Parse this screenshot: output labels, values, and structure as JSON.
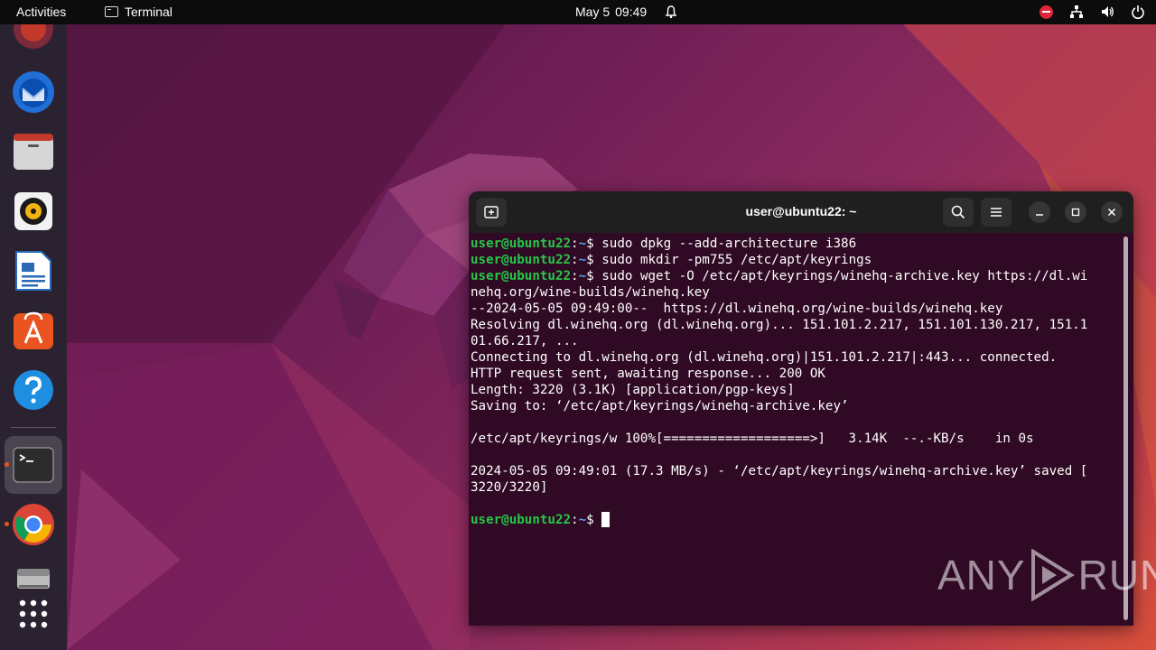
{
  "topbar": {
    "activities": "Activities",
    "app_name": "Terminal",
    "date": "May 5",
    "time": "09:49"
  },
  "dock": {
    "items": [
      "firefox-icon",
      "thunderbird-icon",
      "files-icon",
      "rhythmbox-icon",
      "libreoffice-writer-icon",
      "ubuntu-software-icon",
      "help-icon",
      "terminal-icon",
      "chrome-icon",
      "disk-icon",
      "show-apps-icon"
    ],
    "accent": "#e95420"
  },
  "terminal": {
    "title": "user@ubuntu22: ~",
    "prompt_user": "user@ubuntu22",
    "prompt_sep": ":",
    "prompt_path": "~",
    "prompt_dollar": "$ ",
    "lines": [
      {
        "type": "cmd",
        "text": "sudo dpkg --add-architecture i386"
      },
      {
        "type": "cmd",
        "text": "sudo mkdir -pm755 /etc/apt/keyrings"
      },
      {
        "type": "cmd",
        "text": "sudo wget -O /etc/apt/keyrings/winehq-archive.key https://dl.wi"
      },
      {
        "type": "out",
        "text": "nehq.org/wine-builds/winehq.key"
      },
      {
        "type": "out",
        "text": "--2024-05-05 09:49:00--  https://dl.winehq.org/wine-builds/winehq.key"
      },
      {
        "type": "out",
        "text": "Resolving dl.winehq.org (dl.winehq.org)... 151.101.2.217, 151.101.130.217, 151.1"
      },
      {
        "type": "out",
        "text": "01.66.217, ..."
      },
      {
        "type": "out",
        "text": "Connecting to dl.winehq.org (dl.winehq.org)|151.101.2.217|:443... connected."
      },
      {
        "type": "out",
        "text": "HTTP request sent, awaiting response... 200 OK"
      },
      {
        "type": "out",
        "text": "Length: 3220 (3.1K) [application/pgp-keys]"
      },
      {
        "type": "out",
        "text": "Saving to: ‘/etc/apt/keyrings/winehq-archive.key’"
      },
      {
        "type": "out",
        "text": ""
      },
      {
        "type": "out",
        "text": "/etc/apt/keyrings/w 100%[===================>]   3.14K  --.-KB/s    in 0s"
      },
      {
        "type": "out",
        "text": ""
      },
      {
        "type": "out",
        "text": "2024-05-05 09:49:01 (17.3 MB/s) - ‘/etc/apt/keyrings/winehq-archive.key’ saved ["
      },
      {
        "type": "out",
        "text": "3220/3220]"
      },
      {
        "type": "out",
        "text": ""
      },
      {
        "type": "prompt",
        "text": ""
      }
    ],
    "colors": {
      "background": "#300a24",
      "user": "#26c649",
      "path": "#5ea1f0",
      "header": "#1f1f1f"
    }
  },
  "watermark": {
    "left": "ANY",
    "right": "RUN"
  }
}
